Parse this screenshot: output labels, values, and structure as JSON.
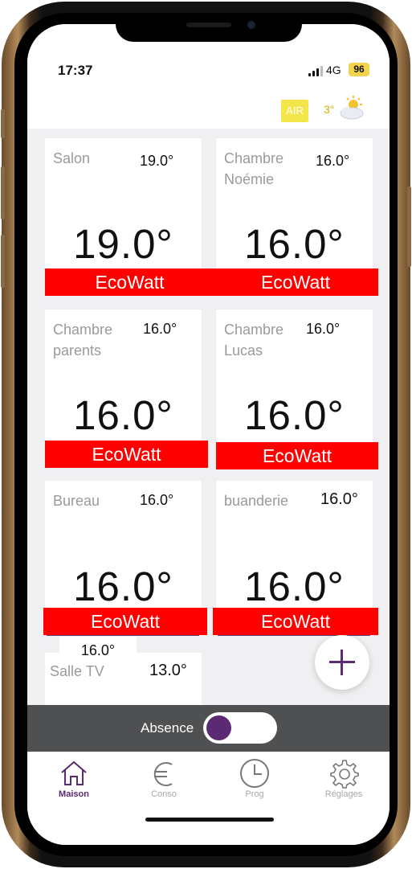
{
  "status": {
    "time": "17:37",
    "network": "4G",
    "battery": "96"
  },
  "header": {
    "air_label": "AIR",
    "weather_temp": "3°",
    "weather_icon": "partly-cloudy-icon"
  },
  "rooms": [
    {
      "name": "Salon",
      "setpoint": "19.0°",
      "temp": "19.0°",
      "eco": "EcoWatt"
    },
    {
      "name": "Chambre\nNoémie",
      "setpoint": "16.0°",
      "temp": "16.0°",
      "eco": "EcoWatt"
    },
    {
      "name": "Chambre\nparents",
      "setpoint": "16.0°",
      "temp": "16.0°",
      "eco": "EcoWatt"
    },
    {
      "name": "Chambre\nLucas",
      "setpoint": "16.0°",
      "temp": "16.0°",
      "eco": "EcoWatt"
    },
    {
      "name": "Bureau",
      "setpoint": "16.0°",
      "temp": "16.0°",
      "eco": "EcoWatt"
    },
    {
      "name": "buanderie",
      "setpoint": "16.0°",
      "temp": "16.0°",
      "eco": "EcoWatt"
    }
  ],
  "salle": {
    "name": "Salle TV",
    "value": "13.0°",
    "overlay": "16.0°"
  },
  "absence": {
    "label": "Absence",
    "enabled": false
  },
  "tabs": [
    {
      "label": "Maison",
      "icon": "house-icon",
      "active": true
    },
    {
      "label": "Conso",
      "icon": "euro-icon",
      "active": false
    },
    {
      "label": "Prog",
      "icon": "clock-icon",
      "active": false
    },
    {
      "label": "Réglages",
      "icon": "gear-icon",
      "active": false
    }
  ],
  "colors": {
    "accent": "#5b2a72",
    "eco_red": "#fe0000",
    "air_yellow": "#f2e64a"
  }
}
